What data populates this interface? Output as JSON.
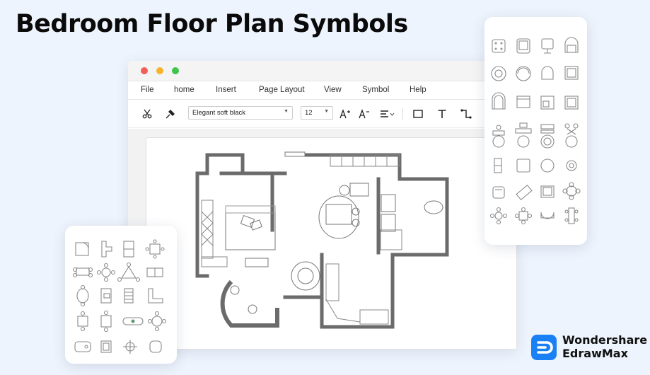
{
  "page": {
    "title": "Bedroom Floor Plan Symbols"
  },
  "window": {
    "menu": [
      "File",
      "home",
      "Insert",
      "Page Layout",
      "View",
      "Symbol",
      "Help"
    ],
    "toolbar": {
      "font_family": "Elegant soft black",
      "font_size": "12",
      "icons": [
        "cut-icon",
        "format-painter-icon",
        "increase-font-icon",
        "decrease-font-icon",
        "align-icon",
        "rectangle-icon",
        "text-icon",
        "connector-icon"
      ]
    },
    "traffic_lights": {
      "close": "#f25f57",
      "minimize": "#f5b42c",
      "maximize": "#3ec54a"
    }
  },
  "symbol_panels": {
    "right_icons": [
      "chair-icon",
      "armchair-icon",
      "office-chair-icon",
      "sofa-chair-icon",
      "round-chair-icon",
      "round-armchair-icon",
      "arched-chair-icon",
      "square-chair-icon",
      "arched-seat-icon",
      "bench-icon",
      "table-icon",
      "desk-icon",
      "dining-set-icon",
      "dining-set-round-icon",
      "dining-set-ornate-icon",
      "dining-set-flower-icon",
      "double-seat-icon",
      "square-table-icon",
      "round-table-icon",
      "round-stool-icon",
      "lounge-chair-icon",
      "chaise-icon",
      "cushion-chair-icon",
      "flower-table-icon",
      "round-seating-icon",
      "square-seating-icon",
      "sectional-icon",
      "long-table-icon"
    ],
    "left_icons": [
      "sofa-corner-icon",
      "sofa-l-icon",
      "bunk-icon",
      "square-dining-icon",
      "dining-4-icon",
      "round-dining-icon",
      "triangle-dining-icon",
      "kitchen-unit-icon",
      "dining-oval-icon",
      "corner-desk-icon",
      "stairs-icon",
      "l-corner-icon",
      "table-4-icon",
      "table-4b-icon",
      "banquet-table-icon",
      "round-table-6-icon",
      "bathtub-icon",
      "cabinet-icon",
      "round-lamp-icon",
      "pouf-icon"
    ]
  },
  "brand": {
    "line1": "Wondershare",
    "line2": "EdrawMax",
    "color": "#1a80f5"
  }
}
